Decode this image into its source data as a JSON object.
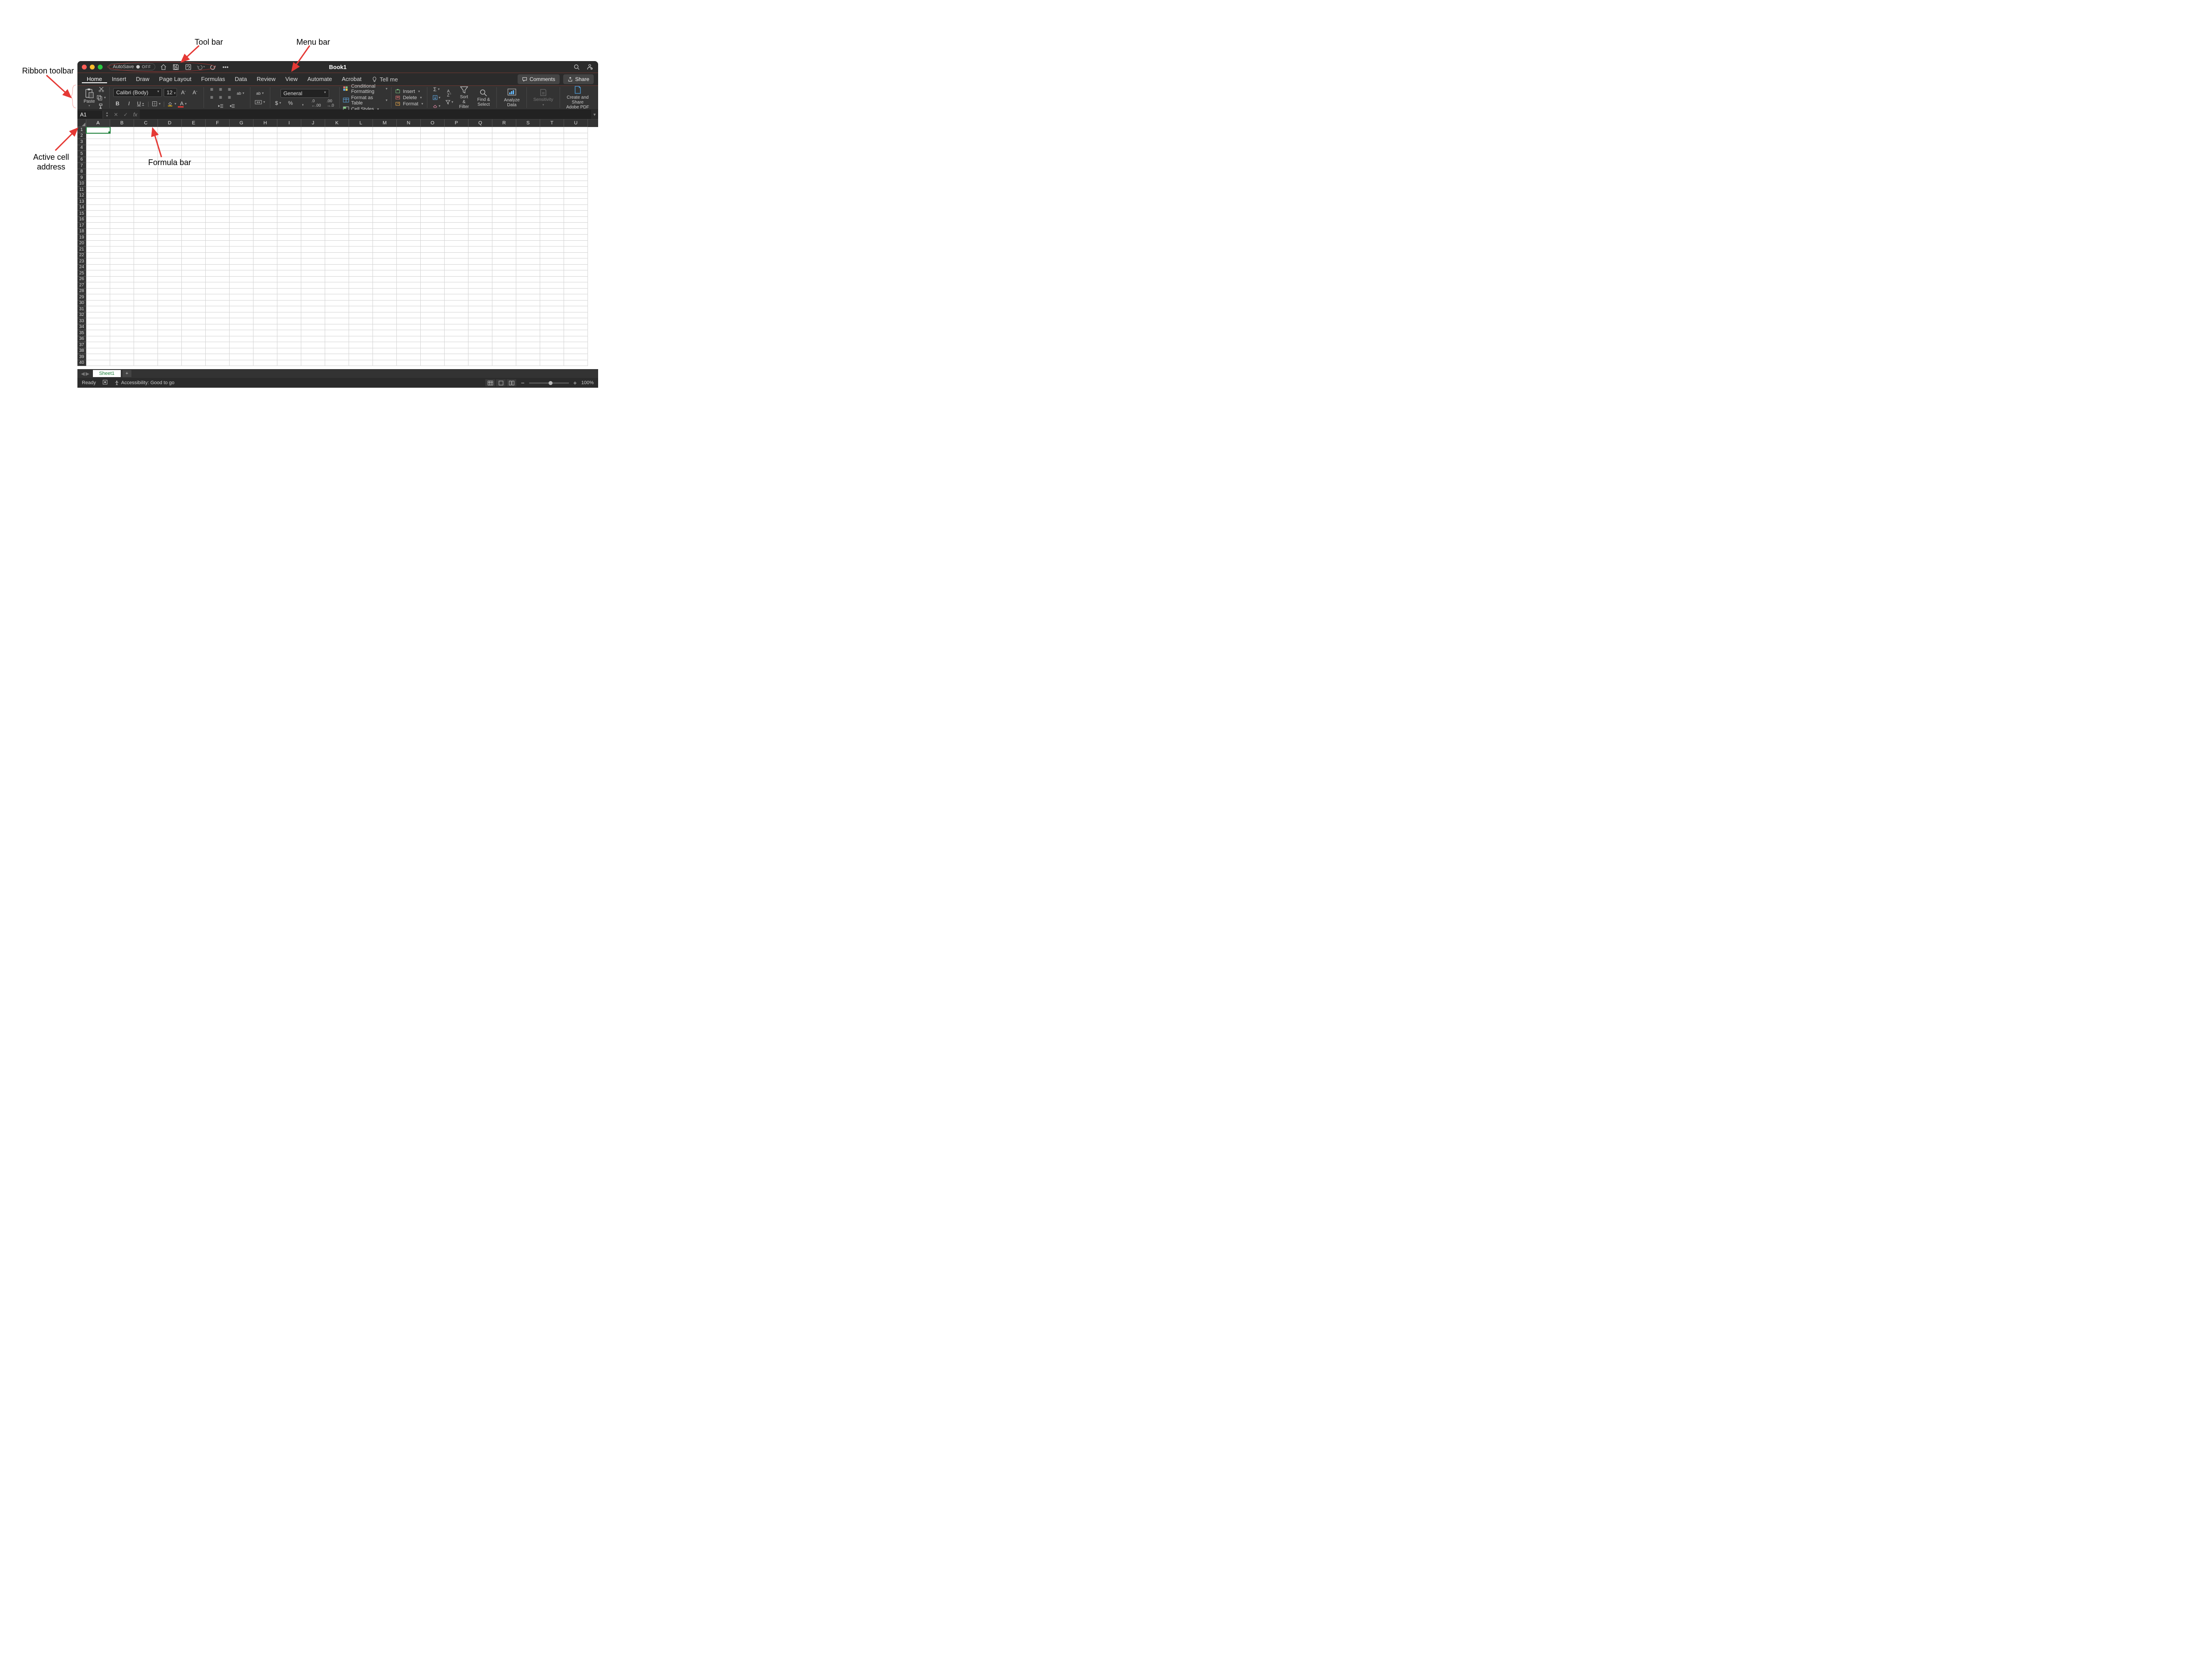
{
  "annotations": {
    "toolbar": "Tool bar",
    "menubar": "Menu bar",
    "ribbon": "Ribbon toolbar",
    "activecell": "Active cell address",
    "formulabar": "Formula bar"
  },
  "titlebar": {
    "autosave_label": "AutoSave",
    "autosave_state": "OFF",
    "title": "Book1"
  },
  "tabs": [
    "Home",
    "Insert",
    "Draw",
    "Page Layout",
    "Formulas",
    "Data",
    "Review",
    "View",
    "Automate",
    "Acrobat"
  ],
  "tell_me": "Tell me",
  "comments_btn": "Comments",
  "share_btn": "Share",
  "ribbon": {
    "paste": "Paste",
    "font_name": "Calibri (Body)",
    "font_size": "12",
    "number_format": "General",
    "cond_fmt": "Conditional Formatting",
    "fmt_table": "Format as Table",
    "cell_styles": "Cell Styles",
    "insert": "Insert",
    "delete": "Delete",
    "format": "Format",
    "sort_filter": "Sort & Filter",
    "find_select": "Find & Select",
    "analyze": "Analyze Data",
    "sensitivity": "Sensitivity",
    "adobe": "Create and Share Adobe PDF"
  },
  "name_box": "A1",
  "columns": [
    "A",
    "B",
    "C",
    "D",
    "E",
    "F",
    "G",
    "H",
    "I",
    "J",
    "K",
    "L",
    "M",
    "N",
    "O",
    "P",
    "Q",
    "R",
    "S",
    "T",
    "U"
  ],
  "row_count": 40,
  "sheet_tab": "Sheet1",
  "status": {
    "ready": "Ready",
    "accessibility": "Accessibility: Good to go",
    "zoom": "100%"
  }
}
